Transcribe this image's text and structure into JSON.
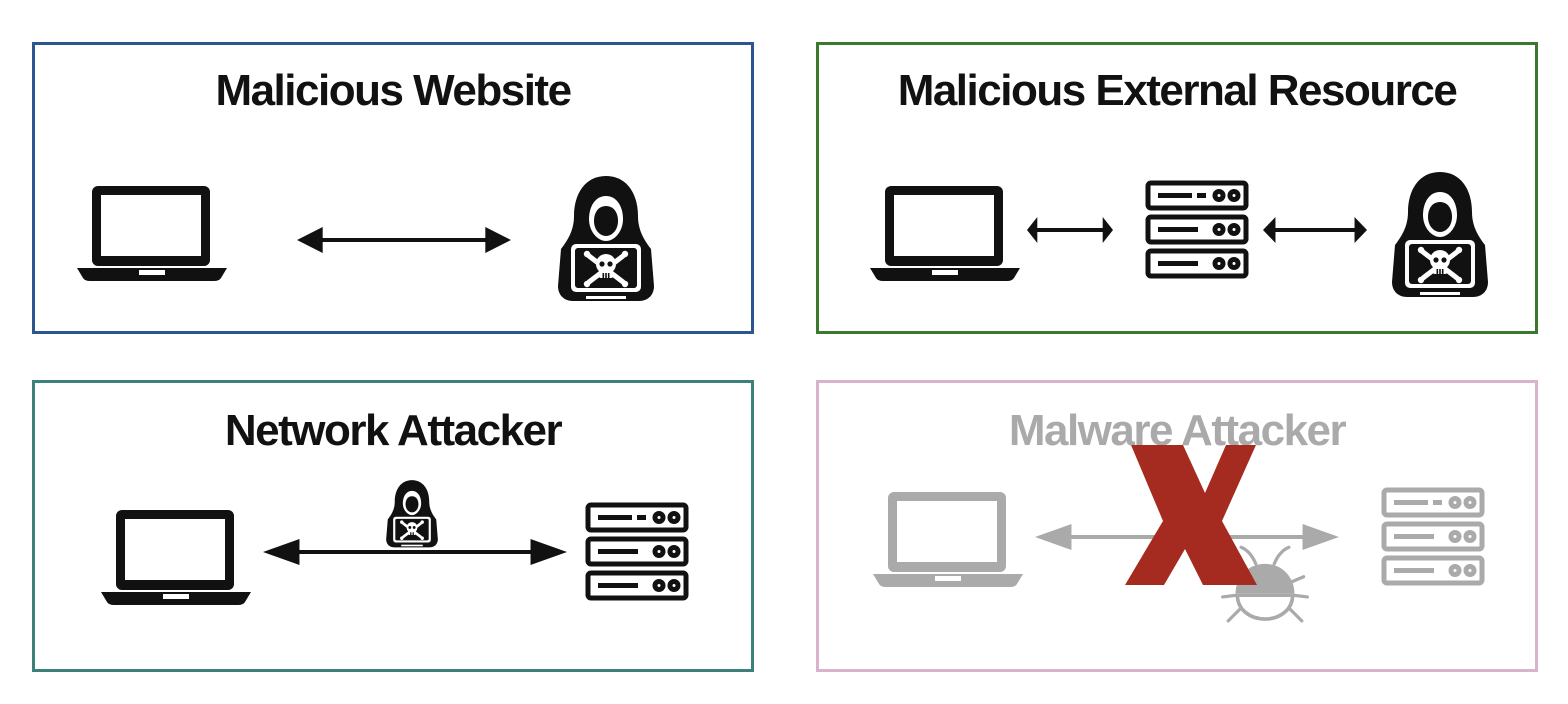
{
  "panels": {
    "malicious_website": {
      "title": "Malicious Website",
      "border_color": "#2b5690",
      "icons": [
        "laptop-icon",
        "double-arrow-icon",
        "hooded-hacker-icon"
      ]
    },
    "malicious_external_resource": {
      "title": "Malicious External Resource",
      "border_color": "#3b7a2e",
      "icons": [
        "laptop-icon",
        "double-arrow-icon",
        "server-rack-icon",
        "double-arrow-icon",
        "hooded-hacker-icon"
      ]
    },
    "network_attacker": {
      "title": "Network Attacker",
      "border_color": "#3b8079",
      "icons": [
        "laptop-icon",
        "double-arrow-icon",
        "hooded-hacker-icon",
        "server-rack-icon"
      ]
    },
    "malware_attacker": {
      "title": "Malware Attacker",
      "border_color": "#d9b3cc",
      "dimmed": true,
      "crossed_out": true,
      "icons": [
        "laptop-icon",
        "double-arrow-icon",
        "bug-icon",
        "server-rack-icon",
        "red-x-mark-icon"
      ]
    }
  },
  "colors": {
    "icon": "#111111",
    "dimmed": "#aaaaaa",
    "cross": "#a52a1f"
  }
}
